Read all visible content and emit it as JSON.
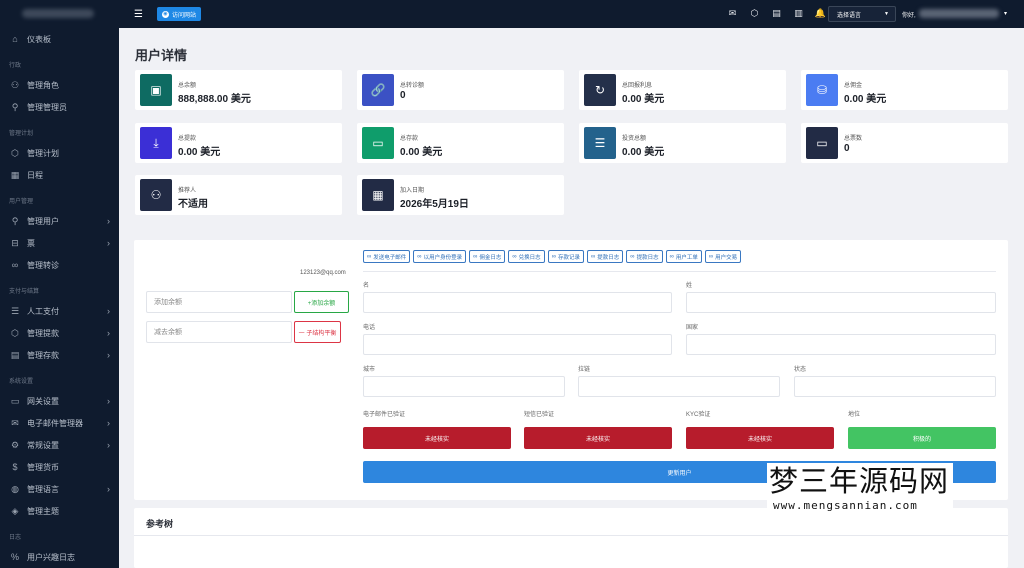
{
  "sidebar": {
    "items": [
      {
        "type": "item",
        "label": "仪表板",
        "icon": "home-icon",
        "glyph": "⌂",
        "arrow": false
      },
      {
        "type": "section",
        "label": "行政"
      },
      {
        "type": "item",
        "label": "管理角色",
        "icon": "users-icon",
        "glyph": "⚇",
        "arrow": false
      },
      {
        "type": "item",
        "label": "管理管理员",
        "icon": "user-check-icon",
        "glyph": "⚲",
        "arrow": false
      },
      {
        "type": "section",
        "label": "管理计划"
      },
      {
        "type": "item",
        "label": "管理计划",
        "icon": "box-icon",
        "glyph": "⬡",
        "arrow": false
      },
      {
        "type": "item",
        "label": "日程",
        "icon": "calendar-icon",
        "glyph": "▦",
        "arrow": false
      },
      {
        "type": "section",
        "label": "用户管理"
      },
      {
        "type": "item",
        "label": "管理用户",
        "icon": "user-icon",
        "glyph": "⚲",
        "arrow": true
      },
      {
        "type": "item",
        "label": "票",
        "icon": "inbox-icon",
        "glyph": "⊟",
        "arrow": true
      },
      {
        "type": "item",
        "label": "管理转诊",
        "icon": "link-icon",
        "glyph": "∞",
        "arrow": false
      },
      {
        "type": "section",
        "label": "支付与结算"
      },
      {
        "type": "item",
        "label": "人工支付",
        "icon": "database-icon",
        "glyph": "☰",
        "arrow": true
      },
      {
        "type": "item",
        "label": "管理提款",
        "icon": "package-icon",
        "glyph": "⬡",
        "arrow": true
      },
      {
        "type": "item",
        "label": "管理存款",
        "icon": "table-icon",
        "glyph": "▤",
        "arrow": true
      },
      {
        "type": "section",
        "label": "系统设置"
      },
      {
        "type": "item",
        "label": "网关设置",
        "icon": "credit-card-icon",
        "glyph": "▭",
        "arrow": true
      },
      {
        "type": "item",
        "label": "电子邮件管理器",
        "icon": "mail-icon",
        "glyph": "✉",
        "arrow": true
      },
      {
        "type": "item",
        "label": "常规设置",
        "icon": "settings-icon",
        "glyph": "⚙",
        "arrow": true
      },
      {
        "type": "item",
        "label": "管理货币",
        "icon": "dollar-icon",
        "glyph": "$",
        "arrow": false
      },
      {
        "type": "item",
        "label": "管理语言",
        "icon": "globe-icon",
        "glyph": "◍",
        "arrow": true
      },
      {
        "type": "item",
        "label": "管理主题",
        "icon": "layers-icon",
        "glyph": "◈",
        "arrow": false
      },
      {
        "type": "section",
        "label": "日志"
      },
      {
        "type": "item",
        "label": "用户兴趣日志",
        "icon": "percent-icon",
        "glyph": "%",
        "arrow": false
      }
    ]
  },
  "topbar": {
    "visit_label": "访问网站",
    "language": "选择语言",
    "greeting": "你好,"
  },
  "page": {
    "title": "用户详情"
  },
  "stats": [
    {
      "label": "总余额",
      "value": "888,888.00 美元",
      "color": "#0e6b62",
      "icon": "wallet-icon",
      "glyph": "▣"
    },
    {
      "label": "总转诊额",
      "value": "0",
      "color": "#3b51c4",
      "icon": "link-icon",
      "glyph": "🔗"
    },
    {
      "label": "总回报利息",
      "value": "0.00 美元",
      "color": "#24304a",
      "icon": "refresh-icon",
      "glyph": "↻"
    },
    {
      "label": "总佣金",
      "value": "0.00 美元",
      "color": "#4b7cf2",
      "icon": "coins-icon",
      "glyph": "⛁"
    },
    {
      "label": "总提款",
      "value": "0.00 美元",
      "color": "#3b2fd6",
      "icon": "hand-money-icon",
      "glyph": "⤓"
    },
    {
      "label": "总存款",
      "value": "0.00 美元",
      "color": "#0f9d6b",
      "icon": "card-icon",
      "glyph": "▭"
    },
    {
      "label": "投资总额",
      "value": "0.00 美元",
      "color": "#23628c",
      "icon": "stack-icon",
      "glyph": "☰"
    },
    {
      "label": "总票数",
      "value": "0",
      "color": "#222b45",
      "icon": "ticket-icon",
      "glyph": "▭"
    },
    {
      "label": "推荐人",
      "value": "不适用",
      "color": "#222b45",
      "icon": "group-icon",
      "glyph": "⚇"
    },
    {
      "label": "加入日期",
      "value": "2026年5月19日",
      "color": "#222b45",
      "icon": "calendar-icon",
      "glyph": "▦"
    }
  ],
  "detail": {
    "email": "123123@qq.com",
    "add_placeholder": "添加余额",
    "add_button": "+添加余额",
    "sub_placeholder": "减去余额",
    "sub_button": "一 子结构平衡",
    "tabs": [
      "发送电子邮件",
      "以用户身份登录",
      "佣金日志",
      "兑换日志",
      "存款记录",
      "提款日志",
      "提款日志",
      "用户工单",
      "用户交易"
    ],
    "labels": {
      "first_name": "名",
      "last_name": "姓",
      "phone": "电话",
      "country": "国家",
      "city": "城市",
      "zip": "拉链",
      "state": "状态",
      "email_verified": "电子邮件已验证",
      "sms_verified": "短信已验证",
      "kyc_verified": "KYC验证",
      "status": "地位"
    },
    "buttons": {
      "email_verified": "未经核实",
      "sms_verified": "未经核实",
      "kyc_verified": "未经核实",
      "status": "积极的",
      "update": "更新用户"
    },
    "colors": {
      "unverified": "#b71c2c",
      "active": "#43c463",
      "update": "#2e86de"
    }
  },
  "tree": {
    "title": "参考树"
  },
  "watermark": {
    "line1": "梦三年源码网",
    "line2": "www.mengsannian.com"
  }
}
